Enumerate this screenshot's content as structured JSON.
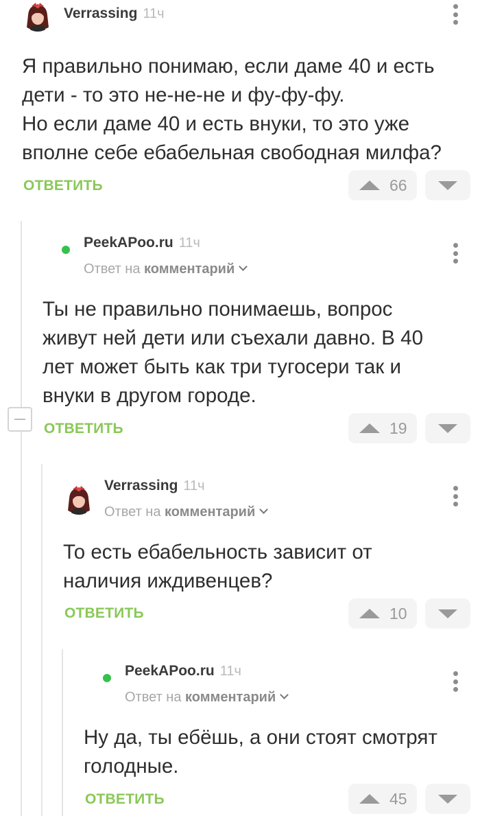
{
  "thread": {
    "comments": [
      {
        "author": "Verrassing",
        "time": "11ч",
        "reply_prefix": "",
        "reply_target": "",
        "text": "Я правильно понимаю, если даме 40 и есть\nдети - то это не-не-не и фу-фу-фу.\nНо если даме 40 и есть внуки, то это уже\nвполне себе ебабельная свободная милфа?",
        "reply_label": "ОТВЕТИТЬ",
        "score": "66"
      },
      {
        "author": "PeekAPoo.ru",
        "time": "11ч",
        "reply_prefix": "Ответ на",
        "reply_target": "комментарий",
        "text": "Ты не правильно понимаешь, вопрос\nживут ней дети или съехали давно. В 40\nлет может быть как три тугосери так и\nвнуки в другом городе.",
        "reply_label": "ОТВЕТИТЬ",
        "score": "19"
      },
      {
        "author": "Verrassing",
        "time": "11ч",
        "reply_prefix": "Ответ на",
        "reply_target": "комментарий",
        "text": "То есть ебабельность зависит от\nналичия иждивенцев?",
        "reply_label": "ОТВЕТИТЬ",
        "score": "10"
      },
      {
        "author": "PeekAPoo.ru",
        "time": "11ч",
        "reply_prefix": "Ответ на",
        "reply_target": "комментарий",
        "text": "Ну да, ты ебёшь, а они стоят смотрят\nголодные.",
        "reply_label": "ОТВЕТИТЬ",
        "score": "45"
      }
    ]
  },
  "icons": {
    "upvote": "triangle-up-icon",
    "downvote": "triangle-down-icon",
    "menu": "kebab-menu-icon",
    "collapse": "minus-icon",
    "expand_reply": "chevron-down-icon"
  },
  "colors": {
    "accent_green": "#8ac858",
    "online_dot": "#35c24a",
    "author_text": "#3a3a3a",
    "muted_text": "#a7a7a7",
    "vote_bg": "#f4f4f4",
    "thread_line": "#e4e4e4"
  }
}
